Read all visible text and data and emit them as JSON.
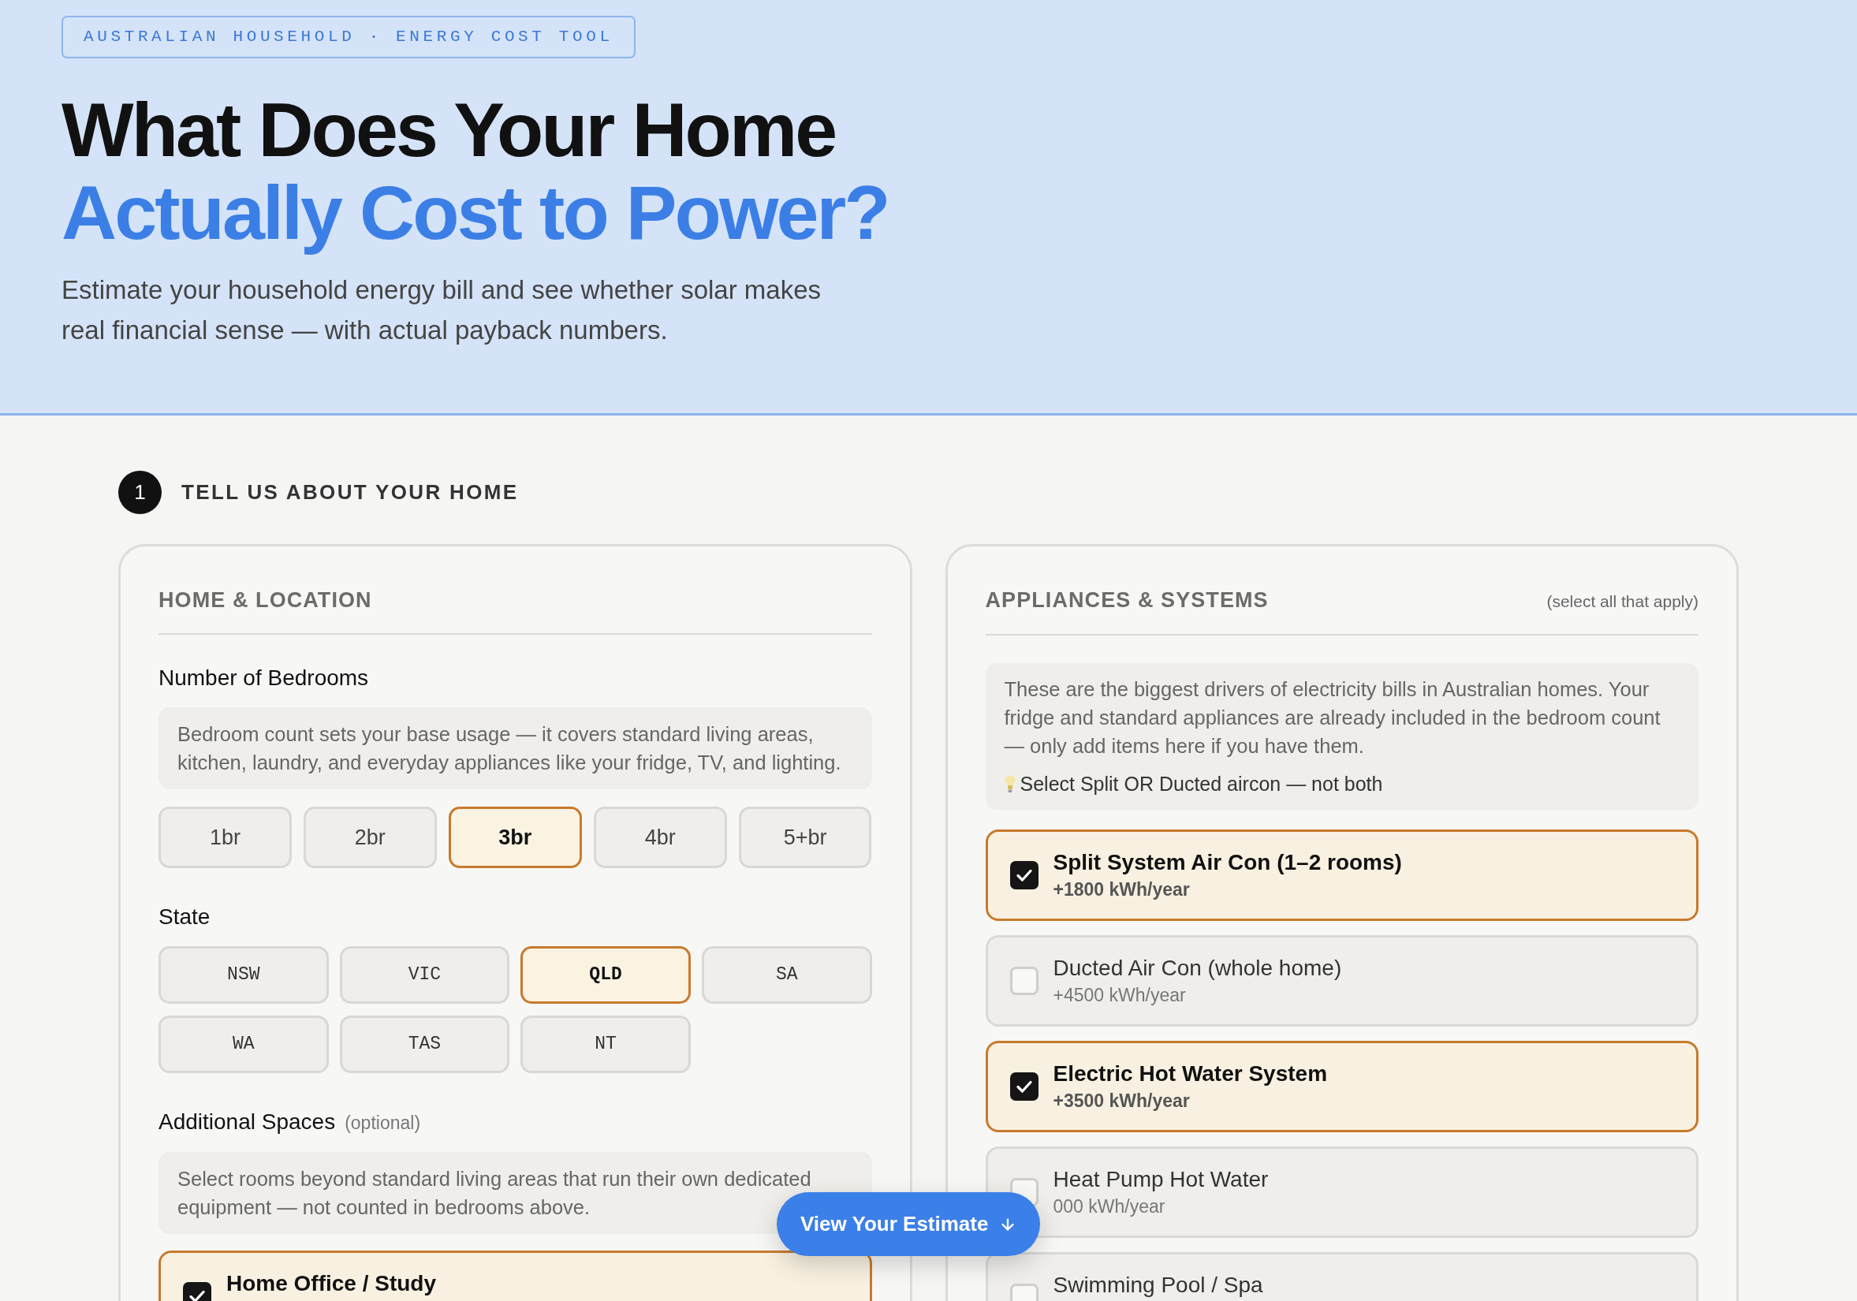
{
  "header": {
    "badge": "AUSTRALIAN HOUSEHOLD · ENERGY COST TOOL",
    "title": "What Does Your Home",
    "title_accent": "Actually Cost to Power?",
    "subtitle": "Estimate your household energy bill and see whether solar makes real financial sense — with actual payback numbers."
  },
  "step": {
    "number": "1",
    "title": "TELL US ABOUT YOUR HOME"
  },
  "home_location": {
    "title": "HOME & LOCATION",
    "bedrooms": {
      "label": "Number of Bedrooms",
      "info": "Bedroom count sets your base usage — it covers standard living areas, kitchen, laundry, and everyday appliances like your fridge, TV, and lighting.",
      "options": [
        {
          "label": "1br",
          "selected": false
        },
        {
          "label": "2br",
          "selected": false
        },
        {
          "label": "3br",
          "selected": true
        },
        {
          "label": "4br",
          "selected": false
        },
        {
          "label": "5+br",
          "selected": false
        }
      ]
    },
    "state": {
      "label": "State",
      "options": [
        {
          "label": "NSW",
          "selected": false
        },
        {
          "label": "VIC",
          "selected": false
        },
        {
          "label": "QLD",
          "selected": true
        },
        {
          "label": "SA",
          "selected": false
        },
        {
          "label": "WA",
          "selected": false
        },
        {
          "label": "TAS",
          "selected": false
        },
        {
          "label": "NT",
          "selected": false
        }
      ]
    },
    "additional_spaces": {
      "label": "Additional Spaces",
      "note": "(optional)",
      "info": "Select rooms beyond standard living areas that run their own dedicated equipment — not counted in bedrooms above.",
      "items": [
        {
          "title": "Home Office / Study",
          "checked": true
        }
      ]
    }
  },
  "appliances": {
    "title": "APPLIANCES & SYSTEMS",
    "note": "(select all that apply)",
    "info": "These are the biggest drivers of electricity bills in Australian homes. Your fridge and standard appliances are already included in the bedroom count — only add items here if you have them.",
    "tip": "Select Split OR Ducted aircon — not both",
    "items": [
      {
        "title": "Split System Air Con (1–2 rooms)",
        "detail": "+1800 kWh/year",
        "checked": true
      },
      {
        "title": "Ducted Air Con (whole home)",
        "detail": "+4500 kWh/year",
        "checked": false
      },
      {
        "title": "Electric Hot Water System",
        "detail": "+3500 kWh/year",
        "checked": true
      },
      {
        "title": "Heat Pump Hot Water",
        "detail": "000 kWh/year",
        "checked": false
      },
      {
        "title": "Swimming Pool / Spa",
        "checked": false
      }
    ]
  },
  "estimate_button": {
    "label": "View Your Estimate"
  }
}
